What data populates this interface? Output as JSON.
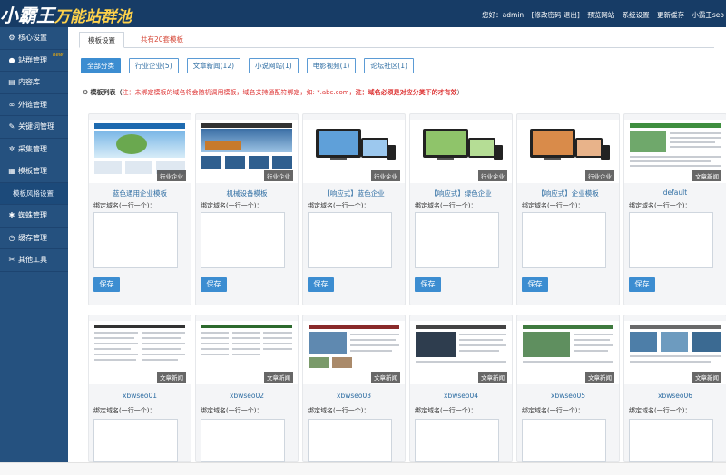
{
  "header": {
    "logo_main": "小霸王",
    "logo_sub": "万能站群池",
    "greeting": "您好：admin",
    "change_pw": "[修改密码 退出]",
    "links": [
      "预览网站",
      "系统设置",
      "更新缓存",
      "小霸王seo"
    ]
  },
  "sidebar": {
    "items": [
      {
        "label": "核心设置",
        "icon": "gear-icon"
      },
      {
        "label": "站群管理",
        "icon": "user-icon",
        "badge": "new"
      },
      {
        "label": "内容库",
        "icon": "document-icon"
      },
      {
        "label": "外链管理",
        "icon": "link-icon"
      },
      {
        "label": "关键词管理",
        "icon": "pencil-icon"
      },
      {
        "label": "采集管理",
        "icon": "gear-icon"
      },
      {
        "label": "模板管理",
        "icon": "grid-icon"
      },
      {
        "label": "模板风格设置",
        "icon": "",
        "sub": true
      },
      {
        "label": "蜘蛛管理",
        "icon": "bug-icon"
      },
      {
        "label": "缓存管理",
        "icon": "clock-icon"
      },
      {
        "label": "其他工具",
        "icon": "tools-icon"
      }
    ]
  },
  "tabs": {
    "active": "模板设置",
    "count": "共有20套模板"
  },
  "filters": [
    "全部分类",
    "行业企业(5)",
    "文章新闻(12)",
    "小说网站(1)",
    "电影视频(1)",
    "论坛社区(1)"
  ],
  "list_head": {
    "title": "模板列表（",
    "note": "注：未绑定模板的域名将会随机调用模板，域名支持通配符绑定，如: *.abc.com，",
    "note_bold": "注：域名必须是对应分类下的才有效",
    "close": "）"
  },
  "card_common": {
    "bind_label": "绑定域名(一行一个)：",
    "save_label": "保存"
  },
  "templates_row1": [
    {
      "name": "蓝色通用企业模板",
      "tag": "行业企业"
    },
    {
      "name": "机械设备模板",
      "tag": "行业企业"
    },
    {
      "name": "【响应式】蓝色企业",
      "tag": "行业企业"
    },
    {
      "name": "【响应式】绿色企业",
      "tag": "行业企业"
    },
    {
      "name": "【响应式】企业模板",
      "tag": "行业企业"
    },
    {
      "name": "default",
      "tag": "文章新闻"
    }
  ],
  "templates_row2": [
    {
      "name": "xbwseo01",
      "tag": "文章新闻"
    },
    {
      "name": "xbwseo02",
      "tag": "文章新闻"
    },
    {
      "name": "xbwseo03",
      "tag": "文章新闻"
    },
    {
      "name": "xbwseo04",
      "tag": "文章新闻"
    },
    {
      "name": "xbwseo05",
      "tag": "文章新闻"
    },
    {
      "name": "xbwseo06",
      "tag": "文章新闻"
    }
  ],
  "colors": {
    "header_bg": "#173c66",
    "sidebar_bg": "#25517f",
    "accent": "#3c8dd1",
    "warning_red": "#d33"
  }
}
